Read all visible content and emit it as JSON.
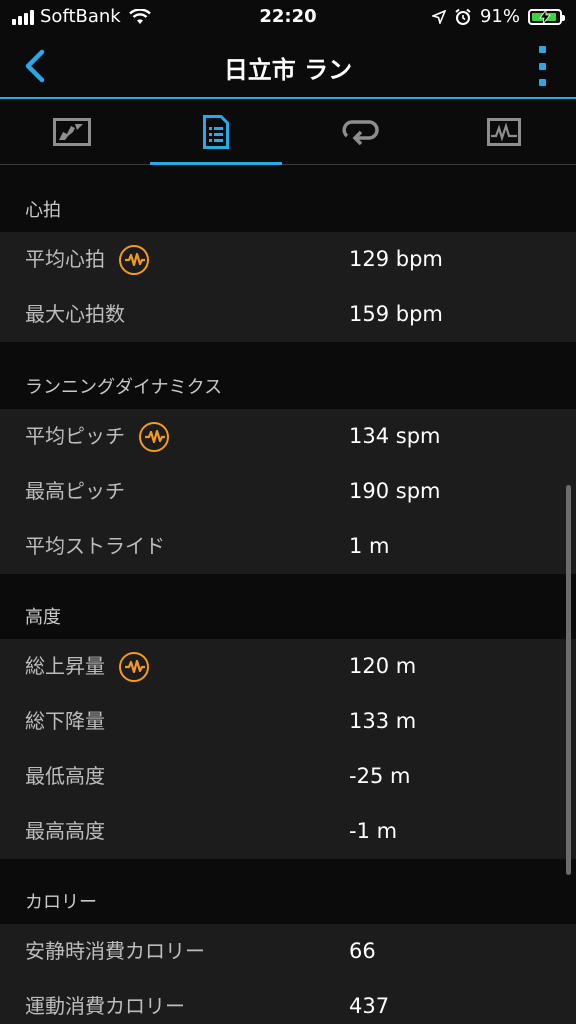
{
  "status_bar": {
    "carrier": "SoftBank",
    "time": "22:20",
    "battery_percent": "91%",
    "battery_level": 0.91,
    "icons": [
      "signal-icon",
      "wifi-icon",
      "location-arrow-icon",
      "alarm-icon",
      "battery-charging-icon"
    ]
  },
  "nav": {
    "title": "日立市 ラン",
    "back_icon": "chevron-left-icon",
    "more_icon": "vertical-dots-icon",
    "accent_color": "#2aa8e8"
  },
  "tabs": [
    {
      "name": "map",
      "icon": "map-icon",
      "active": false
    },
    {
      "name": "stats",
      "icon": "document-list-icon",
      "active": true
    },
    {
      "name": "laps",
      "icon": "loop-icon",
      "active": false
    },
    {
      "name": "charts",
      "icon": "chart-icon",
      "active": false
    }
  ],
  "sections": {
    "heart": {
      "title": "心拍",
      "rows": [
        {
          "label": "平均心拍",
          "value": "129 bpm"
        },
        {
          "label": "最大心拍数",
          "value": "159 bpm"
        }
      ]
    },
    "dynamics": {
      "title": "ランニングダイナミクス",
      "rows": [
        {
          "label": "平均ピッチ",
          "value": "134 spm"
        },
        {
          "label": "最高ピッチ",
          "value": "190 spm"
        },
        {
          "label": "平均ストライド",
          "value": "1 m"
        }
      ]
    },
    "elevation": {
      "title": "高度",
      "rows": [
        {
          "label": "総上昇量",
          "value": "120 m"
        },
        {
          "label": "総下降量",
          "value": "133 m"
        },
        {
          "label": "最低高度",
          "value": "-25 m"
        },
        {
          "label": "最高高度",
          "value": "-1 m"
        }
      ]
    },
    "calories": {
      "title": "カロリー",
      "rows": [
        {
          "label": "安静時消費カロリー",
          "value": "66"
        },
        {
          "label": "運動消費カロリー",
          "value": "437"
        }
      ]
    }
  },
  "chip_icon": "heart-rate-wave-icon",
  "chip_color": "#f29a1f"
}
